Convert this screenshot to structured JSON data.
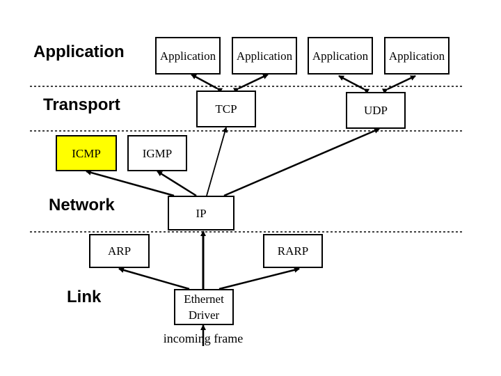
{
  "layers": {
    "application": "Application",
    "transport": "Transport",
    "network": "Network",
    "link": "Link"
  },
  "boxes": {
    "app1": "Application",
    "app2": "Application",
    "app3": "Application",
    "app4": "Application",
    "tcp": "TCP",
    "udp": "UDP",
    "icmp": "ICMP",
    "igmp": "IGMP",
    "ip": "IP",
    "arp": "ARP",
    "rarp": "RARP",
    "ethernet_line1": "Ethernet",
    "ethernet_line2": "Driver"
  },
  "incoming": "incoming frame",
  "colors": {
    "highlight": "#ffff00",
    "line": "#000000"
  }
}
